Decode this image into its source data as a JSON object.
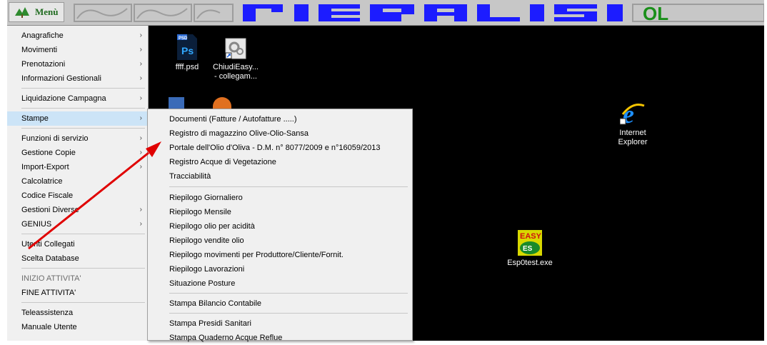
{
  "topbar": {
    "menu_label": "Menù",
    "banner_text": "PIERALISI",
    "banner_suffix": "OL",
    "colors": {
      "banner_bg": "#c7c7c7",
      "banner_block": "#1c1cff",
      "banner_suffix": "#1a8f1a"
    }
  },
  "desktop": {
    "icons": [
      {
        "name": "psd-file-icon",
        "label": "ffff.psd"
      },
      {
        "name": "shortcut-icon",
        "label": "ChiudiEasy...\n- collegam..."
      },
      {
        "name": "internet-explorer-icon",
        "label": "Internet\nExplorer"
      },
      {
        "name": "easy-exe-icon",
        "label": "Esp0test.exe"
      }
    ]
  },
  "menu": {
    "items": [
      {
        "label": "Anagrafiche",
        "arrow": "›"
      },
      {
        "label": "Movimenti",
        "arrow": "›"
      },
      {
        "label": "Prenotazioni",
        "arrow": "›"
      },
      {
        "label": "Informazioni Gestionali",
        "arrow": "›"
      },
      {
        "label": "Liquidazione Campagna",
        "arrow": "›"
      },
      {
        "label": "Stampe",
        "arrow": "›"
      },
      {
        "label": "Funzioni di servizio",
        "arrow": "›"
      },
      {
        "label": "Gestione Copie",
        "arrow": "›"
      },
      {
        "label": "Import-Export",
        "arrow": "›"
      },
      {
        "label": "Calcolatrice",
        "arrow": ""
      },
      {
        "label": "Codice Fiscale",
        "arrow": ""
      },
      {
        "label": "Gestioni Diverse",
        "arrow": "›"
      },
      {
        "label": "GENIUS",
        "arrow": "›"
      },
      {
        "label": "Utenti Collegati",
        "arrow": ""
      },
      {
        "label": "Scelta Database",
        "arrow": ""
      },
      {
        "label": "INIZIO ATTIVITA'",
        "arrow": ""
      },
      {
        "label": "FINE ATTIVITA'",
        "arrow": ""
      },
      {
        "label": "Teleassistenza",
        "arrow": ""
      },
      {
        "label": "Manuale Utente",
        "arrow": ""
      }
    ]
  },
  "submenu": {
    "items": [
      "Documenti (Fatture / Autofatture .....)",
      "Registro di magazzino Olive-Olio-Sansa",
      "Portale dell'Olio d'Oliva - D.M. n° 8077/2009 e n°16059/2013",
      "Registro Acque di Vegetazione",
      "Tracciabilità",
      "Riepilogo Giornaliero",
      "Riepilogo Mensile",
      "Riepilogo olio per acidità",
      "Riepilogo vendite olio",
      "Riepilogo movimenti per Produttore/Cliente/Fornit.",
      "Riepilogo Lavorazioni",
      "Situazione Posture",
      "Stampa Bilancio Contabile",
      "Stampa Presidi Sanitari",
      "Stampa Quaderno Acque Reflue"
    ]
  },
  "annotation": {
    "color": "#e00000"
  }
}
